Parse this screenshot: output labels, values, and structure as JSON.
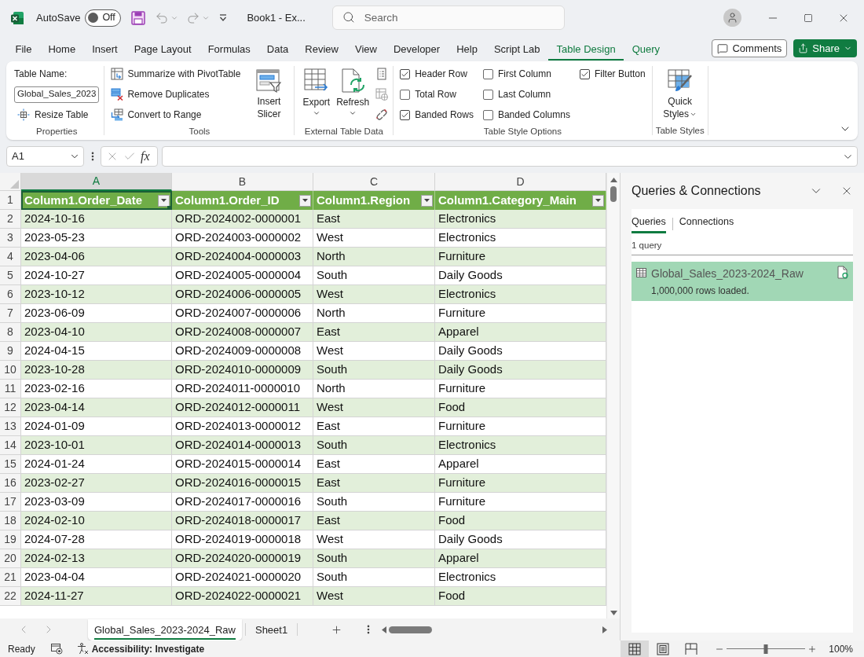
{
  "title_bar": {
    "autosave_label": "AutoSave",
    "autosave": {
      "on": false,
      "label": "Off"
    },
    "document_title": "Book1 - Ex...",
    "search": {
      "placeholder": "Search"
    }
  },
  "ribbon_tabs": [
    {
      "label": "File",
      "selected": false,
      "kind": "standard"
    },
    {
      "label": "Home",
      "selected": false,
      "kind": "standard"
    },
    {
      "label": "Insert",
      "selected": false,
      "kind": "standard"
    },
    {
      "label": "Page Layout",
      "selected": false,
      "kind": "standard"
    },
    {
      "label": "Formulas",
      "selected": false,
      "kind": "standard"
    },
    {
      "label": "Data",
      "selected": false,
      "kind": "standard"
    },
    {
      "label": "Review",
      "selected": false,
      "kind": "standard"
    },
    {
      "label": "View",
      "selected": false,
      "kind": "standard"
    },
    {
      "label": "Developer",
      "selected": false,
      "kind": "standard"
    },
    {
      "label": "Help",
      "selected": false,
      "kind": "standard"
    },
    {
      "label": "Script Lab",
      "selected": false,
      "kind": "standard"
    },
    {
      "label": "Table Design",
      "selected": true,
      "kind": "contextual"
    },
    {
      "label": "Query",
      "selected": false,
      "kind": "contextual"
    }
  ],
  "header_buttons": {
    "comments": "Comments",
    "share": "Share"
  },
  "ribbon": {
    "properties": {
      "title": "Properties",
      "table_name_label": "Table Name:",
      "table_name": "Global_Sales_2023",
      "resize": "Resize Table"
    },
    "tools": {
      "title": "Tools",
      "commands": [
        "Summarize with PivotTable",
        "Remove Duplicates",
        "Convert to Range"
      ],
      "slicer": "Insert Slicer"
    },
    "external_data": {
      "title": "External Table Data",
      "export": "Export",
      "refresh": "Refresh"
    },
    "style_options": {
      "title": "Table Style Options",
      "options": [
        {
          "label": "Header Row",
          "checked": true
        },
        {
          "label": "Total Row",
          "checked": false
        },
        {
          "label": "Banded Rows",
          "checked": true
        },
        {
          "label": "First Column",
          "checked": false
        },
        {
          "label": "Last Column",
          "checked": false
        },
        {
          "label": "Banded Columns",
          "checked": false
        },
        {
          "label": "Filter Button",
          "checked": true
        }
      ]
    },
    "table_styles": {
      "title": "Table Styles",
      "quick_styles": "Quick Styles"
    }
  },
  "formula_bar": {
    "name_box": "A1",
    "function_label": "fx"
  },
  "sheet": {
    "columns": [
      {
        "letter": "A",
        "selected": true
      },
      {
        "letter": "B",
        "selected": false
      },
      {
        "letter": "C",
        "selected": false
      },
      {
        "letter": "D",
        "selected": false
      }
    ],
    "header_row": {
      "number": "1",
      "cells": [
        {
          "text": "Column1.Order_Date",
          "selected": true
        },
        {
          "text": "Column1.Order_ID",
          "selected": false
        },
        {
          "text": "Column1.Region",
          "selected": false
        },
        {
          "text": "Column1.Category_Main",
          "selected": false
        }
      ]
    },
    "rows": [
      {
        "number": "2",
        "cells": [
          "2024-10-16",
          "ORD-2024002-0000001",
          "East",
          "Electronics"
        ]
      },
      {
        "number": "3",
        "cells": [
          "2023-05-23",
          "ORD-2024003-0000002",
          "West",
          "Electronics"
        ]
      },
      {
        "number": "4",
        "cells": [
          "2023-04-06",
          "ORD-2024004-0000003",
          "North",
          "Furniture"
        ]
      },
      {
        "number": "5",
        "cells": [
          "2024-10-27",
          "ORD-2024005-0000004",
          "South",
          "Daily Goods"
        ]
      },
      {
        "number": "6",
        "cells": [
          "2023-10-12",
          "ORD-2024006-0000005",
          "West",
          "Electronics"
        ]
      },
      {
        "number": "7",
        "cells": [
          "2023-06-09",
          "ORD-2024007-0000006",
          "North",
          "Furniture"
        ]
      },
      {
        "number": "8",
        "cells": [
          "2023-04-10",
          "ORD-2024008-0000007",
          "East",
          "Apparel"
        ]
      },
      {
        "number": "9",
        "cells": [
          "2024-04-15",
          "ORD-2024009-0000008",
          "West",
          "Daily Goods"
        ]
      },
      {
        "number": "10",
        "cells": [
          "2023-10-28",
          "ORD-2024010-0000009",
          "South",
          "Daily Goods"
        ]
      },
      {
        "number": "11",
        "cells": [
          "2023-02-16",
          "ORD-2024011-0000010",
          "North",
          "Furniture"
        ]
      },
      {
        "number": "12",
        "cells": [
          "2023-04-14",
          "ORD-2024012-0000011",
          "West",
          "Food"
        ]
      },
      {
        "number": "13",
        "cells": [
          "2024-01-09",
          "ORD-2024013-0000012",
          "East",
          "Furniture"
        ]
      },
      {
        "number": "14",
        "cells": [
          "2023-10-01",
          "ORD-2024014-0000013",
          "South",
          "Electronics"
        ]
      },
      {
        "number": "15",
        "cells": [
          "2024-01-24",
          "ORD-2024015-0000014",
          "East",
          "Apparel"
        ]
      },
      {
        "number": "16",
        "cells": [
          "2023-02-27",
          "ORD-2024016-0000015",
          "East",
          "Furniture"
        ]
      },
      {
        "number": "17",
        "cells": [
          "2023-03-09",
          "ORD-2024017-0000016",
          "South",
          "Furniture"
        ]
      },
      {
        "number": "18",
        "cells": [
          "2024-02-10",
          "ORD-2024018-0000017",
          "East",
          "Food"
        ]
      },
      {
        "number": "19",
        "cells": [
          "2024-07-28",
          "ORD-2024019-0000018",
          "West",
          "Daily Goods"
        ]
      },
      {
        "number": "20",
        "cells": [
          "2024-02-13",
          "ORD-2024020-0000019",
          "South",
          "Apparel"
        ]
      },
      {
        "number": "21",
        "cells": [
          "2023-04-04",
          "ORD-2024021-0000020",
          "South",
          "Electronics"
        ]
      },
      {
        "number": "22",
        "cells": [
          "2024-11-27",
          "ORD-2024022-0000021",
          "West",
          "Food"
        ]
      }
    ]
  },
  "sheet_tabs": [
    {
      "label": "Global_Sales_2023-2024_Raw",
      "selected": true
    },
    {
      "label": "Sheet1",
      "selected": false
    }
  ],
  "queries_panel": {
    "title": "Queries & Connections",
    "tabs": [
      {
        "label": "Queries",
        "selected": true
      },
      {
        "label": "Connections",
        "selected": false
      }
    ],
    "count": "1 query",
    "items": [
      {
        "name": "Global_Sales_2023-2024_Raw",
        "status": "1,000,000 rows loaded.",
        "selected": true
      }
    ]
  },
  "status_bar": {
    "mode": "Ready",
    "accessibility": "Accessibility: Investigate",
    "views": [
      {
        "kind": "normal",
        "selected": true
      },
      {
        "kind": "page_layout",
        "selected": false
      },
      {
        "kind": "page_break",
        "selected": false
      }
    ],
    "zoom": {
      "level": 0.5,
      "label": "100%"
    }
  }
}
